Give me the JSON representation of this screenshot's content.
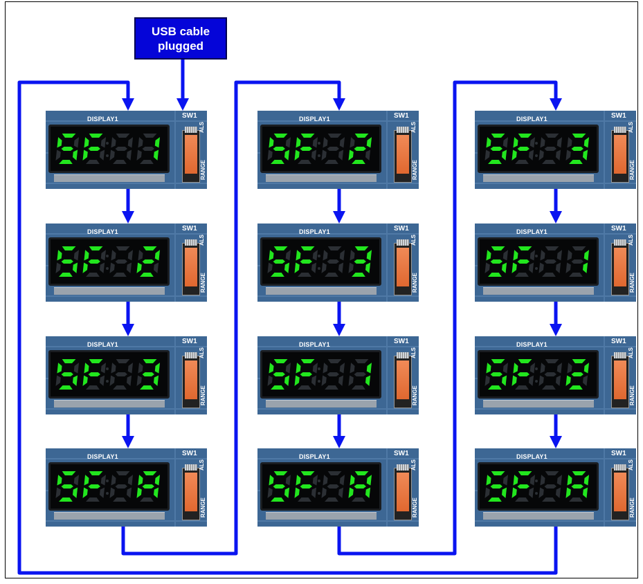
{
  "usb_box": {
    "line1": "USB cable",
    "line2": "plugged"
  },
  "colors": {
    "connector": "#0a14f0",
    "lit_segment": "#22e61e",
    "dim_segment": "#2b2f34",
    "pcb": "#3d6794"
  },
  "panel_labels": {
    "display": "DISPLAY1",
    "switch": "SW1",
    "als": "ALS",
    "range": "RANGE"
  },
  "columns": [
    {
      "states": [
        {
          "digits": [
            "5",
            "F",
            "",
            "1"
          ]
        },
        {
          "digits": [
            "5",
            "F",
            "",
            "2"
          ]
        },
        {
          "digits": [
            "5",
            "F",
            "",
            "3"
          ]
        },
        {
          "digits": [
            "5",
            "F",
            "",
            "A"
          ]
        }
      ]
    },
    {
      "states": [
        {
          "digits": [
            "5",
            "F",
            "",
            "2"
          ]
        },
        {
          "digits": [
            "5",
            "F",
            "",
            "3"
          ]
        },
        {
          "digits": [
            "5",
            "F",
            "",
            "1"
          ]
        },
        {
          "digits": [
            "5",
            "F",
            "",
            "A"
          ]
        }
      ]
    },
    {
      "states": [
        {
          "digits": [
            "5",
            "F",
            "",
            "3"
          ]
        },
        {
          "digits": [
            "5",
            "F",
            "",
            "1"
          ]
        },
        {
          "digits": [
            "5",
            "F",
            "",
            "2"
          ]
        },
        {
          "digits": [
            "5",
            "F",
            "",
            "A"
          ]
        }
      ]
    }
  ]
}
